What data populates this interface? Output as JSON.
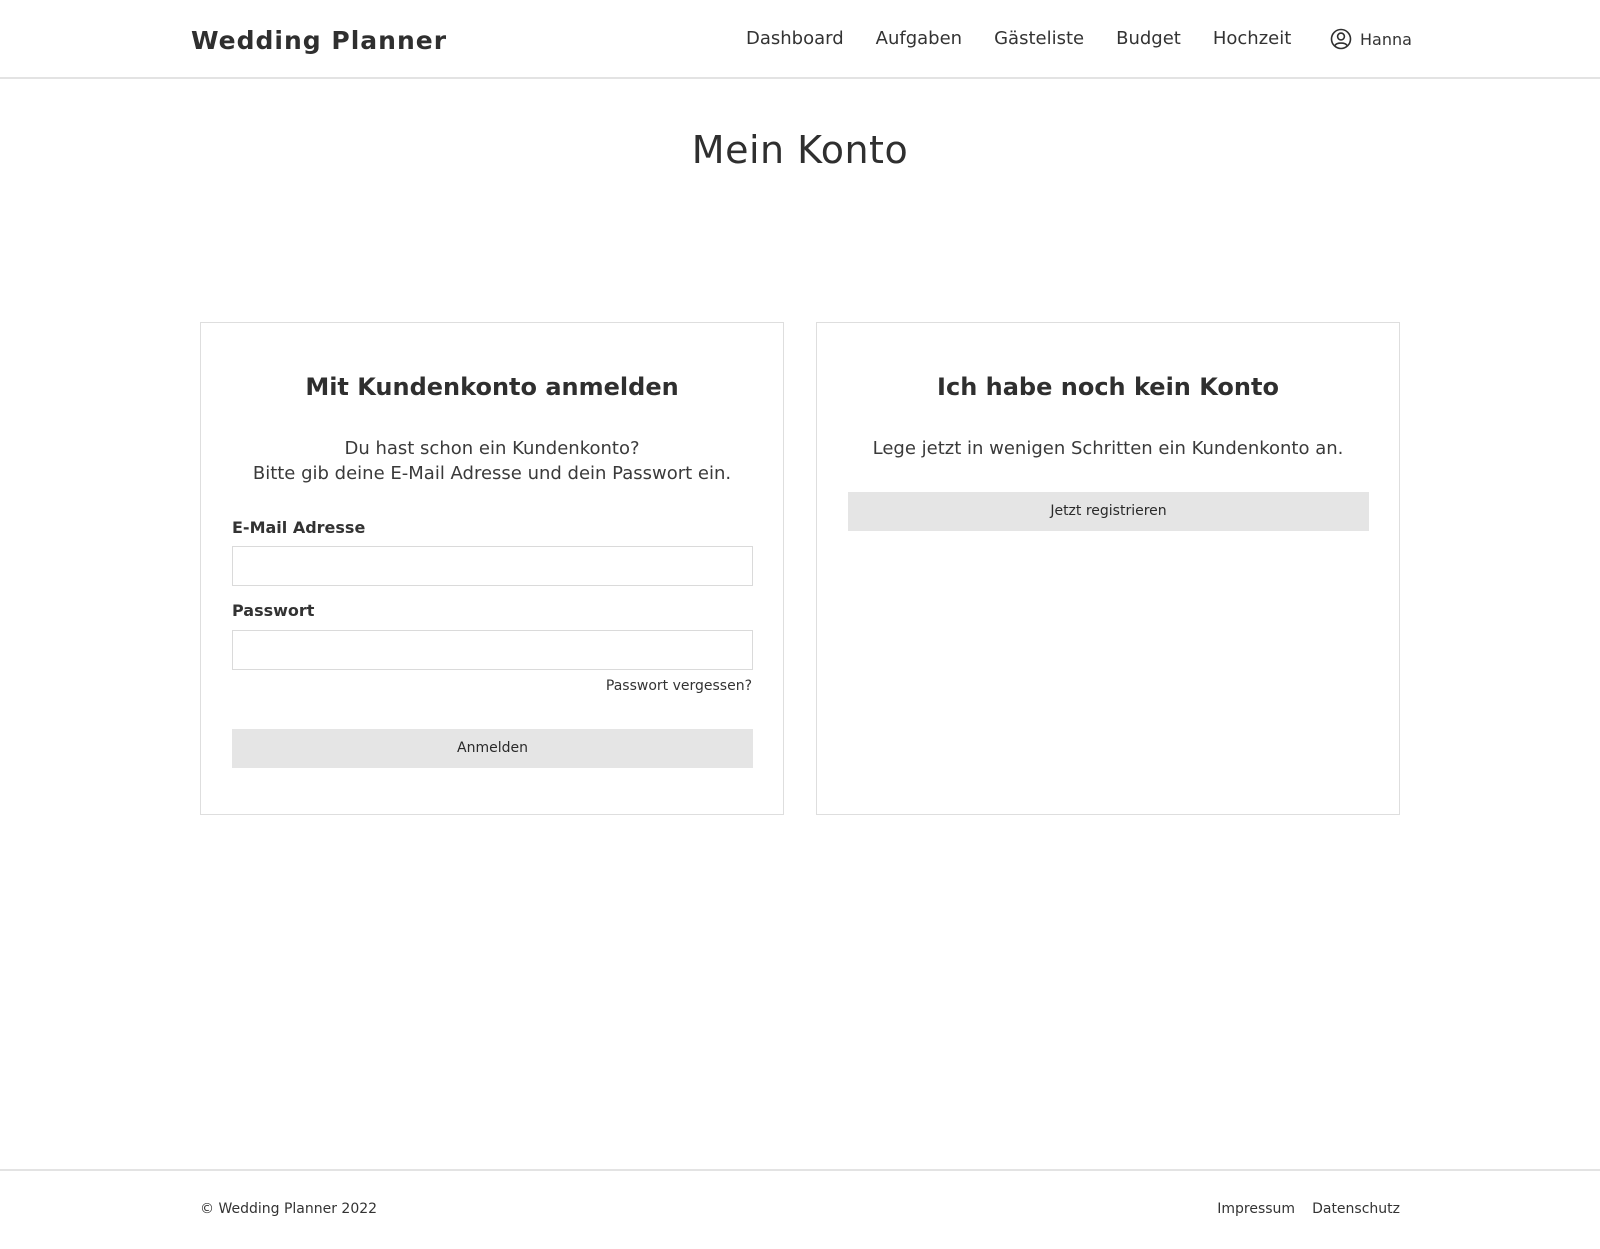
{
  "header": {
    "logo": "Wedding Planner",
    "nav": [
      "Dashboard",
      "Aufgaben",
      "Gästeliste",
      "Budget",
      "Hochzeit"
    ],
    "user_name": "Hanna",
    "user_icon": "user-circle-icon"
  },
  "main": {
    "title": "Mein Konto",
    "login": {
      "title": "Mit Kundenkonto anmelden",
      "text_line1": "Du hast schon ein Kundenkonto?",
      "text_line2": "Bitte gib deine E-Mail Adresse und dein Passwort ein.",
      "email_label": "E-Mail Adresse",
      "email_value": "",
      "password_label": "Passwort",
      "password_value": "",
      "forgot_label": "Passwort vergessen?",
      "submit_label": "Anmelden"
    },
    "register": {
      "title": "Ich habe noch kein Konto",
      "text": "Lege jetzt in wenigen Schritten ein Kundenkonto an.",
      "button_label": "Jetzt registrieren"
    }
  },
  "footer": {
    "copyright": "© Wedding Planner 2022",
    "links": [
      "Impressum",
      "Datenschutz"
    ]
  },
  "colors": {
    "text": "#2f2f2f",
    "button_bg": "#e5e5e5",
    "border": "#dedede"
  }
}
